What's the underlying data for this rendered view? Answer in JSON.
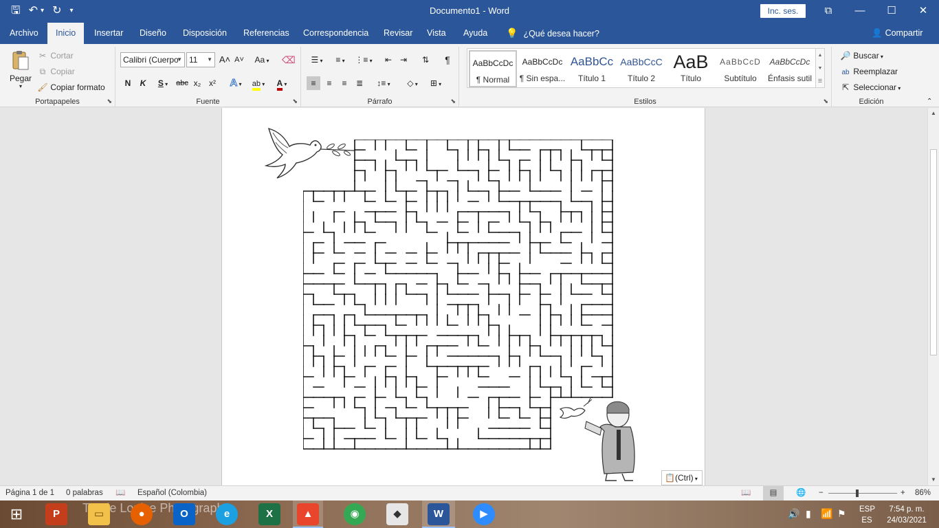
{
  "titlebar": {
    "doc_title": "Documento1  -  Word",
    "signin": "Inc. ses.",
    "qat": {
      "save": "🖫",
      "undo": "↶",
      "undo_dd": "▾",
      "redo": "↻",
      "customize": "▾"
    },
    "window": {
      "restore": "⧉",
      "minimize": "—",
      "maximize": "☐",
      "close": "✕"
    }
  },
  "tabs": [
    {
      "label": "Archivo"
    },
    {
      "label": "Inicio"
    },
    {
      "label": "Insertar"
    },
    {
      "label": "Diseño"
    },
    {
      "label": "Disposición"
    },
    {
      "label": "Referencias"
    },
    {
      "label": "Correspondencia"
    },
    {
      "label": "Revisar"
    },
    {
      "label": "Vista"
    },
    {
      "label": "Ayuda"
    }
  ],
  "tell_me": "¿Qué desea hacer?",
  "share": "Compartir",
  "clipboard": {
    "label": "Portapapeles",
    "paste": "Pegar",
    "cut": "Cortar",
    "copy": "Copiar",
    "format_painter": "Copiar formato"
  },
  "font": {
    "label": "Fuente",
    "family": "Calibri (Cuerpo",
    "size": "11",
    "grow": "A˄",
    "shrink": "A˅",
    "case": "Aa",
    "bold": "N",
    "italic": "K",
    "underline": "S",
    "strike": "abc",
    "subscript": "x₂",
    "superscript": "x²",
    "effects": "A",
    "highlight": "ab",
    "color": "A"
  },
  "paragraph": {
    "label": "Párrafo",
    "pilcrow": "¶"
  },
  "styles": {
    "label": "Estilos",
    "items": [
      {
        "sample": "AaBbCcDc",
        "name": "¶ Normal"
      },
      {
        "sample": "AaBbCcDc",
        "name": "¶ Sin espa..."
      },
      {
        "sample": "AaBbCc",
        "name": "Título 1"
      },
      {
        "sample": "AaBbCcC",
        "name": "Título 2"
      },
      {
        "sample": "AaB",
        "name": "Título"
      },
      {
        "sample": "AaBbCcD",
        "name": "Subtítulo"
      },
      {
        "sample": "AaBbCcDc",
        "name": "Énfasis sutil"
      }
    ]
  },
  "editing": {
    "label": "Edición",
    "find": "Buscar",
    "replace": "Reemplazar",
    "select": "Seleccionar"
  },
  "paste_options": "(Ctrl)",
  "status": {
    "page": "Página 1 de 1",
    "words": "0 palabras",
    "language": "Español (Colombia)",
    "zoom": "86%",
    "zoom_minus": "−",
    "zoom_plus": "+"
  },
  "taskbar": {
    "watermark": "Tracie Louise Photography",
    "lang_top": "ESP",
    "lang_bottom": "ES",
    "time": "7:54 p. m.",
    "date": "24/03/2021",
    "apps": [
      {
        "name": "P"
      },
      {
        "name": "O"
      },
      {
        "name": "X"
      },
      {
        "name": "W"
      }
    ]
  },
  "colors": {
    "brand": "#2b579a",
    "ribbon": "#f3f3f3",
    "canvas": "#e6e6e6",
    "font_color_underline": "#c00000",
    "highlight_yellow": "#ffff00"
  }
}
